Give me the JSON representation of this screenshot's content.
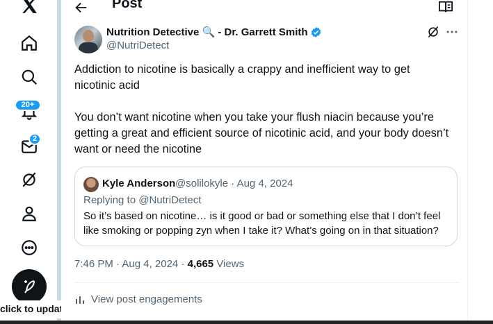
{
  "sidebar": {
    "logo_icon": "x-logo-icon",
    "items": [
      {
        "name": "home",
        "icon": "home-icon"
      },
      {
        "name": "explore",
        "icon": "search-icon"
      },
      {
        "name": "notifications",
        "icon": "bell-icon",
        "badge": "20+"
      },
      {
        "name": "messages",
        "icon": "mail-icon",
        "badge": "2"
      },
      {
        "name": "grok",
        "icon": "grok-icon"
      },
      {
        "name": "profile",
        "icon": "person-icon"
      },
      {
        "name": "more",
        "icon": "more-circle-icon"
      }
    ],
    "compose_icon": "feather-plus-icon"
  },
  "tooltip": {
    "text": "click to update"
  },
  "header": {
    "title": "Post",
    "back_icon": "arrow-left-icon",
    "reader_icon": "book-icon"
  },
  "post": {
    "author_name": "Nutrition Detective 🔍 - Dr. Garrett Smith",
    "handle": "@NutriDetect",
    "text": "Addiction to nicotine is basically a crappy and inefficient way to get nicotinic acid\n\nYou don’t want nicotine when you take your flush niacin because you’re getting a great and efficient source of nicotinic acid, and your body doesn’t want or need the nicotine",
    "time": "7:46 PM · Aug 4, 2024 · ",
    "views_count": "4,665",
    "views_label": " Views",
    "engagements_label": "View post engagements"
  },
  "quote": {
    "author_name": "Kyle Anderson",
    "meta": "@solilokyle · Aug 4, 2024",
    "replying_to": "Replying to @NutriDetect",
    "text": "So it’s based on nicotine… is it good or bad or something else that I don’t feel like smoking or popping zyn when I take it? What’s going on in that situation?"
  },
  "colors": {
    "accent": "#1d9bf0",
    "text": "#0f1419",
    "secondary": "#536471",
    "border": "#cfd9de"
  }
}
